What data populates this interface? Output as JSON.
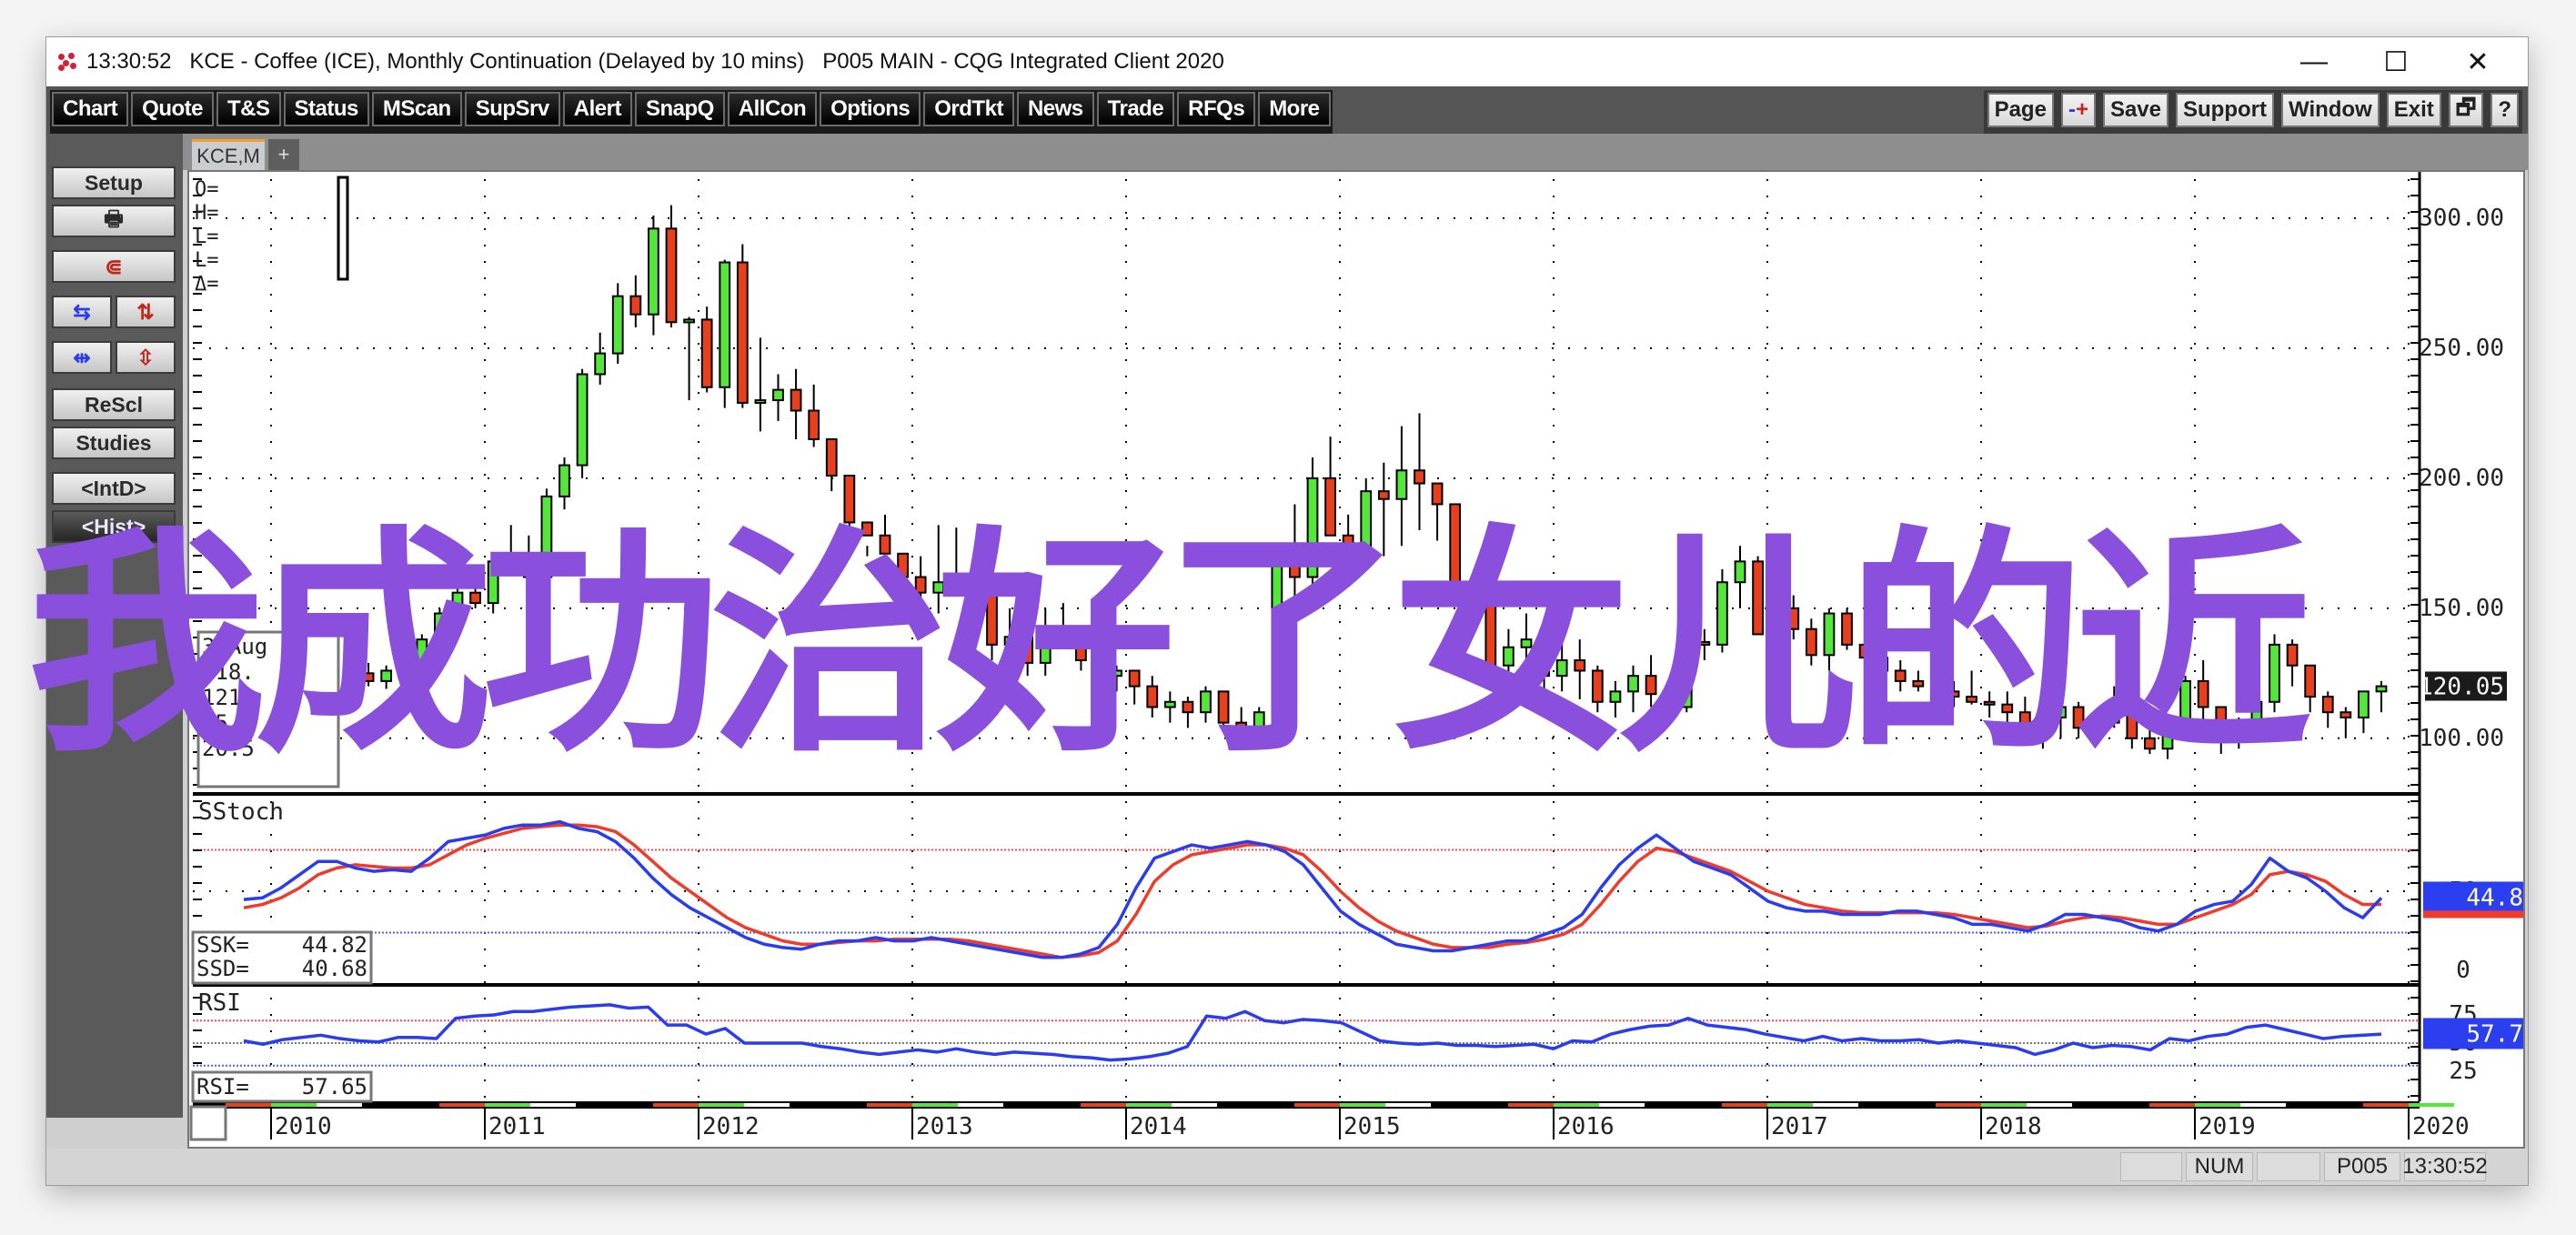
{
  "window": {
    "title_time": "13:30:52",
    "title": "KCE - Coffee (ICE), Monthly Continuation (Delayed by 10 mins)   P005 MAIN - CQG Integrated Client 2020",
    "controls": {
      "minimize": "—",
      "maximize": "☐",
      "close": "✕"
    }
  },
  "toolbar": {
    "left_buttons": [
      "Chart",
      "Quote",
      "T&S",
      "Status",
      "MScan",
      "SupSrv",
      "Alert",
      "SnapQ",
      "AllCon",
      "Options",
      "OrdTkt",
      "News",
      "Trade",
      "RFQs",
      "More"
    ],
    "right_buttons": [
      "Page",
      "-+",
      "Save",
      "Support",
      "Window",
      "Exit",
      "🗗",
      "?"
    ]
  },
  "sidebar": {
    "setup": "Setup",
    "print_icon": "🖶",
    "magnet_icon": "⋐",
    "rescl": "ReScl",
    "studies": "Studies",
    "intd": "<IntD>",
    "hist": "<Hist>"
  },
  "tabs": {
    "active": "KCE,M",
    "add": "+"
  },
  "cursor_box": {
    "lines": [
      "O=",
      "H=",
      "L=",
      "L=",
      "Δ="
    ]
  },
  "bar_info": {
    "date": "3 Aug 20",
    "open": "118.",
    "high": "121.",
    "low": "15.",
    "close": "20.5"
  },
  "price_axis": {
    "labels": [
      "300.00",
      "250.00",
      "200.00",
      "150.00",
      "100.00"
    ],
    "last_price": "120.05"
  },
  "sstoch": {
    "title": "SStoch",
    "ssk_label": "SSK=",
    "ssk_value": "44.82",
    "ssd_label": "SSD=",
    "ssd_value": "40.68",
    "axis_labels": [
      "50",
      "0"
    ],
    "last": "44.8"
  },
  "rsi": {
    "title": "RSI",
    "label": "RSI=",
    "value": "57.65",
    "axis_labels": [
      "75",
      "50",
      "25"
    ],
    "last": "57.7"
  },
  "x_axis": {
    "labels": [
      "2010",
      "2011",
      "2012",
      "2013",
      "2014",
      "2015",
      "2016",
      "2017",
      "2018",
      "2019",
      "2020"
    ]
  },
  "status_bar": {
    "num": "NUM",
    "page": "P005",
    "time": "13:30:52"
  },
  "overlay_text": "我成功治好了女儿的近",
  "colors": {
    "up": "#55e63c",
    "down": "#e8401c",
    "ssk": "#2a3cf0",
    "ssd": "#f03a2a",
    "rsi": "#2a3cf0",
    "overlay": "#8a4fdc",
    "last_price_bg": "#1b1b1b",
    "indicator_tag": "#2b3ff0"
  },
  "chart_data": [
    {
      "type": "candlestick",
      "title": "KCE - Coffee (ICE), Monthly Continuation",
      "xlabel": "",
      "ylabel": "Price",
      "ylim": [
        80,
        315
      ],
      "x_start": "2009-06",
      "interval": "monthly",
      "yticks": [
        100,
        150,
        200,
        250,
        300
      ],
      "ohlc": [
        [
          130,
          136,
          124,
          126
        ],
        [
          126,
          131,
          122,
          128
        ],
        [
          128,
          134,
          124,
          131
        ],
        [
          131,
          136,
          126,
          127
        ],
        [
          127,
          132,
          121,
          124
        ],
        [
          124,
          128,
          118,
          120
        ],
        [
          120,
          127,
          116,
          125
        ],
        [
          125,
          129,
          120,
          122
        ],
        [
          122,
          128,
          119,
          126
        ],
        [
          126,
          131,
          122,
          129
        ],
        [
          129,
          140,
          126,
          138
        ],
        [
          138,
          150,
          134,
          148
        ],
        [
          148,
          158,
          143,
          156
        ],
        [
          156,
          163,
          150,
          152
        ],
        [
          152,
          171,
          148,
          168
        ],
        [
          168,
          182,
          164,
          166
        ],
        [
          166,
          178,
          160,
          162
        ],
        [
          162,
          196,
          158,
          193
        ],
        [
          193,
          208,
          188,
          205
        ],
        [
          205,
          242,
          200,
          240
        ],
        [
          240,
          256,
          236,
          248
        ],
        [
          248,
          275,
          244,
          270
        ],
        [
          270,
          278,
          258,
          263
        ],
        [
          263,
          301,
          255,
          296
        ],
        [
          296,
          305,
          258,
          260
        ],
        [
          260,
          262,
          230,
          261
        ],
        [
          261,
          266,
          233,
          235
        ],
        [
          235,
          284,
          227,
          283
        ],
        [
          283,
          290,
          227,
          229
        ],
        [
          229,
          254,
          218,
          230
        ],
        [
          230,
          240,
          222,
          234
        ],
        [
          234,
          242,
          215,
          226
        ],
        [
          226,
          236,
          212,
          215
        ],
        [
          215,
          205,
          195,
          201
        ],
        [
          201,
          192,
          175,
          183
        ],
        [
          183,
          174,
          170,
          178
        ],
        [
          178,
          186,
          168,
          171
        ],
        [
          171,
          162,
          150,
          162
        ],
        [
          162,
          170,
          140,
          156
        ],
        [
          156,
          182,
          148,
          160
        ],
        [
          160,
          181,
          155,
          156
        ],
        [
          156,
          172,
          152,
          160
        ],
        [
          160,
          156,
          130,
          136
        ],
        [
          136,
          150,
          126,
          139
        ],
        [
          139,
          144,
          124,
          129
        ],
        [
          129,
          150,
          124,
          142
        ],
        [
          142,
          152,
          138,
          140
        ],
        [
          140,
          138,
          126,
          130
        ],
        [
          130,
          134,
          120,
          124
        ],
        [
          124,
          128,
          118,
          126
        ],
        [
          126,
          122,
          113,
          120
        ],
        [
          120,
          124,
          108,
          112
        ],
        [
          112,
          118,
          106,
          114
        ],
        [
          114,
          116,
          104,
          110
        ],
        [
          110,
          120,
          106,
          118
        ],
        [
          118,
          118,
          104,
          106
        ],
        [
          106,
          112,
          100,
          104
        ],
        [
          104,
          112,
          100,
          110
        ],
        [
          110,
          170,
          105,
          168
        ],
        [
          168,
          190,
          150,
          162
        ],
        [
          162,
          208,
          150,
          200
        ],
        [
          200,
          216,
          185,
          178
        ],
        [
          178,
          186,
          168,
          173
        ],
        [
          173,
          200,
          172,
          195
        ],
        [
          195,
          206,
          170,
          192
        ],
        [
          192,
          220,
          174,
          203
        ],
        [
          203,
          225,
          180,
          198
        ],
        [
          198,
          195,
          176,
          190
        ],
        [
          190,
          188,
          168,
          160
        ],
        [
          160,
          150,
          140,
          155
        ],
        [
          155,
          140,
          125,
          128
        ],
        [
          128,
          142,
          120,
          135
        ],
        [
          135,
          148,
          125,
          138
        ],
        [
          138,
          142,
          118,
          124
        ],
        [
          124,
          140,
          118,
          130
        ],
        [
          130,
          138,
          115,
          126
        ],
        [
          126,
          128,
          110,
          114
        ],
        [
          114,
          122,
          108,
          118
        ],
        [
          118,
          128,
          110,
          124
        ],
        [
          124,
          132,
          112,
          117
        ],
        [
          117,
          122,
          108,
          112
        ],
        [
          112,
          140,
          110,
          137
        ],
        [
          137,
          142,
          130,
          136
        ],
        [
          136,
          165,
          133,
          160
        ],
        [
          160,
          174,
          150,
          168
        ],
        [
          168,
          170,
          146,
          140
        ],
        [
          140,
          152,
          136,
          150
        ],
        [
          150,
          155,
          138,
          142
        ],
        [
          142,
          146,
          128,
          132
        ],
        [
          132,
          150,
          126,
          148
        ],
        [
          148,
          150,
          134,
          136
        ],
        [
          136,
          140,
          124,
          131
        ],
        [
          131,
          128,
          122,
          126
        ],
        [
          126,
          130,
          118,
          122
        ],
        [
          122,
          126,
          118,
          120
        ],
        [
          120,
          124,
          114,
          118
        ],
        [
          118,
          122,
          112,
          116
        ],
        [
          116,
          126,
          113,
          114
        ],
        [
          114,
          118,
          108,
          113
        ],
        [
          113,
          118,
          104,
          110
        ],
        [
          110,
          116,
          98,
          103
        ],
        [
          103,
          112,
          96,
          108
        ],
        [
          108,
          118,
          100,
          112
        ],
        [
          112,
          114,
          100,
          104
        ],
        [
          104,
          110,
          99,
          106
        ],
        [
          106,
          120,
          104,
          110
        ],
        [
          110,
          112,
          96,
          100
        ],
        [
          100,
          104,
          94,
          96
        ],
        [
          96,
          108,
          92,
          105
        ],
        [
          105,
          124,
          100,
          122
        ],
        [
          122,
          130,
          100,
          112
        ],
        [
          112,
          106,
          94,
          102
        ],
        [
          102,
          108,
          96,
          104
        ],
        [
          104,
          116,
          100,
          114
        ],
        [
          114,
          140,
          110,
          136
        ],
        [
          136,
          138,
          120,
          128
        ],
        [
          128,
          126,
          110,
          116
        ],
        [
          116,
          118,
          104,
          110
        ],
        [
          110,
          112,
          100,
          108
        ],
        [
          108,
          114,
          102,
          118
        ],
        [
          118,
          122,
          110,
          120
        ]
      ]
    },
    {
      "type": "line",
      "title": "SStoch",
      "ylim": [
        0,
        100
      ],
      "reference_lines": {
        "upper": 75,
        "mid": 50,
        "lower": 25
      },
      "series": [
        {
          "name": "SSK",
          "last": 44.82,
          "values": [
            45,
            46,
            52,
            60,
            68,
            68,
            64,
            62,
            63,
            62,
            70,
            80,
            82,
            84,
            88,
            90,
            90,
            92,
            88,
            86,
            80,
            70,
            58,
            48,
            40,
            34,
            28,
            22,
            18,
            16,
            15,
            18,
            20,
            20,
            22,
            20,
            20,
            22,
            20,
            18,
            16,
            14,
            12,
            10,
            10,
            12,
            16,
            30,
            52,
            70,
            74,
            78,
            76,
            78,
            80,
            78,
            74,
            66,
            52,
            38,
            30,
            24,
            18,
            16,
            14,
            14,
            16,
            18,
            20,
            20,
            24,
            28,
            36,
            52,
            66,
            76,
            84,
            76,
            68,
            64,
            60,
            52,
            44,
            40,
            38,
            38,
            36,
            36,
            36,
            38,
            38,
            36,
            34,
            30,
            30,
            28,
            26,
            30,
            36,
            36,
            34,
            32,
            28,
            26,
            30,
            38,
            42,
            44,
            54,
            70,
            62,
            58,
            50,
            40,
            34,
            46
          ]
        },
        {
          "name": "SSD",
          "last": 40.68,
          "values": [
            40,
            42,
            46,
            52,
            60,
            64,
            66,
            65,
            64,
            64,
            66,
            72,
            78,
            82,
            85,
            88,
            89,
            90,
            90,
            89,
            86,
            78,
            68,
            58,
            50,
            42,
            34,
            28,
            24,
            20,
            18,
            18,
            19,
            20,
            20,
            21,
            21,
            21,
            21,
            20,
            18,
            16,
            14,
            12,
            10,
            11,
            13,
            20,
            36,
            56,
            66,
            72,
            74,
            76,
            78,
            78,
            76,
            72,
            62,
            50,
            40,
            32,
            26,
            22,
            18,
            16,
            16,
            16,
            18,
            19,
            21,
            24,
            30,
            42,
            56,
            68,
            76,
            74,
            70,
            66,
            62,
            56,
            50,
            46,
            42,
            40,
            38,
            37,
            37,
            37,
            37,
            37,
            36,
            34,
            32,
            30,
            28,
            29,
            32,
            34,
            35,
            34,
            32,
            30,
            30,
            34,
            38,
            42,
            48,
            60,
            62,
            60,
            56,
            48,
            42,
            42
          ]
        }
      ]
    },
    {
      "type": "line",
      "title": "RSI",
      "ylim": [
        0,
        100
      ],
      "reference_lines": {
        "upper": 70,
        "mid": 50,
        "lower": 30
      },
      "series": [
        {
          "name": "RSI",
          "last": 57.65,
          "values": [
            52,
            49,
            53,
            55,
            57,
            54,
            52,
            51,
            55,
            55,
            54,
            72,
            74,
            75,
            78,
            78,
            80,
            82,
            83,
            84,
            81,
            82,
            66,
            66,
            58,
            63,
            50,
            50,
            50,
            50,
            47,
            45,
            42,
            40,
            42,
            44,
            42,
            45,
            42,
            40,
            42,
            41,
            40,
            38,
            37,
            35,
            36,
            38,
            41,
            47,
            74,
            72,
            78,
            70,
            68,
            71,
            70,
            68,
            60,
            52,
            50,
            49,
            50,
            48,
            48,
            47,
            48,
            49,
            45,
            52,
            51,
            58,
            62,
            65,
            66,
            72,
            66,
            64,
            62,
            58,
            55,
            52,
            56,
            52,
            54,
            52,
            52,
            53,
            50,
            52,
            50,
            48,
            46,
            40,
            44,
            50,
            46,
            48,
            47,
            44,
            54,
            52,
            56,
            58,
            64,
            66,
            62,
            58,
            54,
            56,
            57,
            58
          ]
        }
      ]
    }
  ]
}
